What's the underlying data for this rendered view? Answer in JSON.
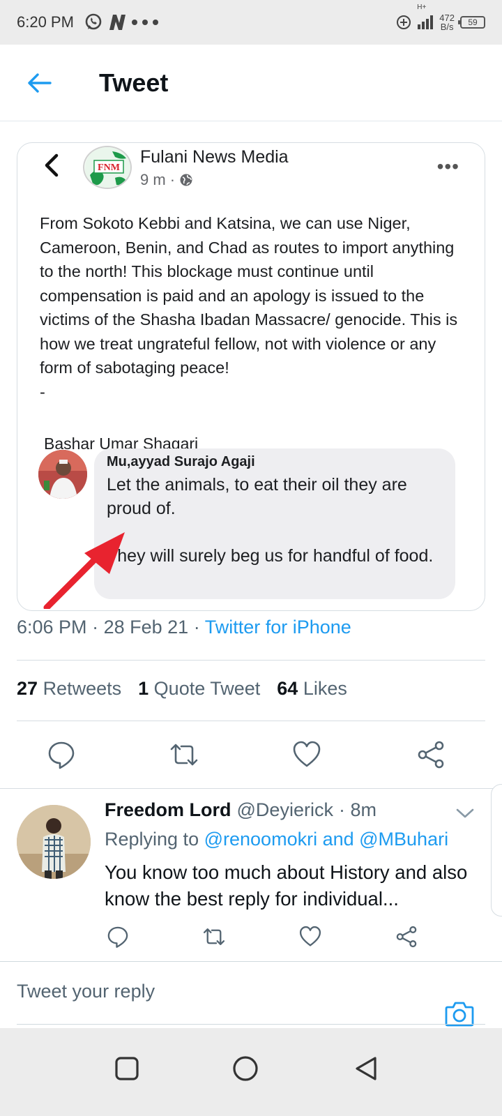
{
  "status_bar": {
    "time": "6:20 PM",
    "network": "H+",
    "speed_value": "472",
    "speed_unit": "B/s",
    "battery": "59",
    "left_icons": [
      "whatsapp-icon",
      "n-app-icon",
      "more-dots-icon"
    ],
    "right_icons": [
      "data-saver-icon",
      "signal-icon",
      "battery-icon"
    ]
  },
  "header": {
    "title": "Tweet",
    "back_icon": "back-arrow-icon"
  },
  "image": {
    "page_name": "Fulani News Media",
    "logo_text": "FNM",
    "time": "9 m ·",
    "post_text": "From Sokoto Kebbi and Katsina, we can use Niger, Cameroon, Benin, and Chad as routes to import anything to the north! This blockage must continue until compensation is paid and an apology is issued to the victims of the Shasha Ibadan Massacre/ genocide. This is how we treat ungrateful fellow, not with violence or any form of sabotaging peace!",
    "post_dash": "-",
    "author_line": "Bashar Umar Shagari",
    "comment": {
      "author": "Mu,ayyad Surajo Agaji",
      "line1": "Let the animals, to eat their oil they are proud of.",
      "line2": "They will surely beg us for handful of food."
    }
  },
  "tweet_meta": {
    "time": "6:06 PM",
    "date": "28 Feb 21",
    "source": "Twitter for iPhone"
  },
  "stats": {
    "retweets_count": "27",
    "retweets_label": "Retweets",
    "quotes_count": "1",
    "quotes_label": "Quote Tweet",
    "likes_count": "64",
    "likes_label": "Likes"
  },
  "actions": [
    "reply-icon",
    "retweet-icon",
    "like-icon",
    "share-icon"
  ],
  "reply": {
    "name": "Freedom Lord",
    "handle": "@Deyierick",
    "time": "· 8m",
    "replying_prefix": "Replying to",
    "mentions": "@renoomokri and @MBuhari",
    "text": "You know too much about History and also know the best reply for individual..."
  },
  "reply_box": {
    "placeholder": "Tweet your reply"
  },
  "nav": [
    "recents-button",
    "home-button",
    "back-button"
  ],
  "colors": {
    "twitter_blue": "#1d9bf0",
    "secondary_text": "#536471",
    "arrow_red": "#e8232f",
    "fnm_green": "#1e9a4a",
    "fnm_red": "#d8202a"
  }
}
